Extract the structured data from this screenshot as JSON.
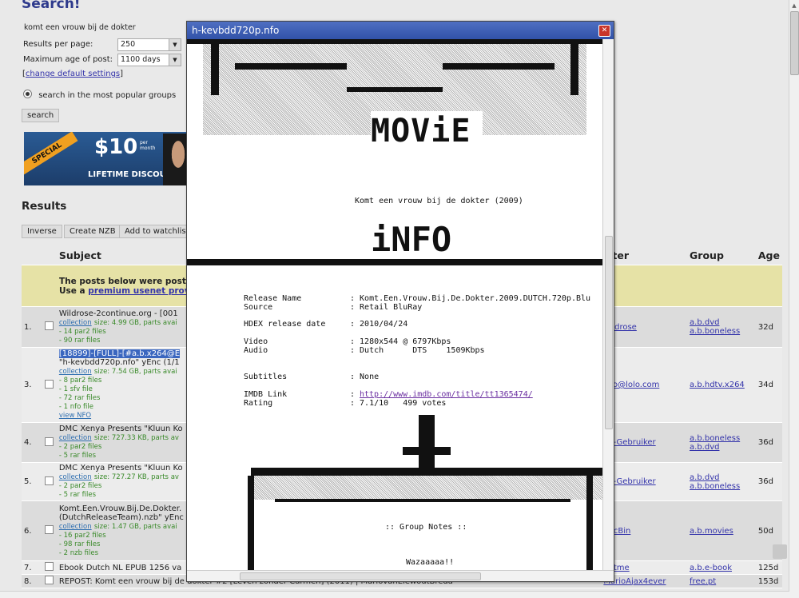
{
  "page": {
    "title": "Search!",
    "search_value": "komt een vrouw bij de dokter",
    "results_per_page_label": "Results per page:",
    "results_per_page_value": "250",
    "max_age_label": "Maximum age of post:",
    "max_age_value": "1100 days",
    "change_defaults_open": "[",
    "change_defaults_link": "change default settings",
    "change_defaults_close": "]",
    "popular_groups_label": "search in the most popular groups",
    "search_button": "search",
    "banner": {
      "special": "SPECIAL",
      "price": "$10",
      "per": "per month",
      "lifetime": "LIFETIME DISCOUNT"
    },
    "results_heading": "Results",
    "buttons": [
      "Inverse",
      "Create NZB",
      "Add to watchlist"
    ]
  },
  "table": {
    "headers": {
      "subject": "Subject",
      "poster": "Poster",
      "group": "Group",
      "age": "Age"
    },
    "notice_line1": "The posts below were poste",
    "notice_line2_prefix": "Use a ",
    "notice_link": "premium usenet prov",
    "rows": [
      {
        "num": "1.",
        "subject": "Wildrose-2continue.org - [001",
        "meta": "collection",
        "size": "size: 4.99 GB, parts avai",
        "extra": [
          "- 14 par2 files",
          "- 90 rar files"
        ],
        "poster": "wildrose",
        "groups": [
          "a.b.dvd",
          "a.b.boneless"
        ],
        "age": "32d"
      },
      {
        "num": "3.",
        "subject_sel": "[18899]-[FULL]-[#a.b.x264@E",
        "subject": "\"h-kevbdd720p.nfo\" yEnc (1/1",
        "meta": "collection",
        "size": "size: 7.54 GB, parts avai",
        "extra": [
          "- 8 par2 files",
          "- 1 sfv file",
          "- 72 rar files",
          "- 1 nfo file"
        ],
        "view_nfo": "view NFO",
        "poster": "lolo@lolo.com",
        "groups": [
          "a.b.hdtv.x264"
        ],
        "age": "34d"
      },
      {
        "num": "4.",
        "subject": "DMC Xenya Presents \"Kluun Ko",
        "meta": "collection",
        "size": "size: 727.33 KB, parts av",
        "extra": [
          "- 2 par2 files",
          "- 5 rar files"
        ],
        "poster": "SP-Gebruiker",
        "groups": [
          "a.b.boneless",
          "a.b.dvd"
        ],
        "age": "36d"
      },
      {
        "num": "5.",
        "subject": "DMC Xenya Presents \"Kluun Ko",
        "meta": "collection",
        "size": "size: 727.27 KB, parts av",
        "extra": [
          "- 2 par2 files",
          "- 5 rar files"
        ],
        "poster": "SP-Gebruiker",
        "groups": [
          "a.b.dvd",
          "a.b.boneless"
        ],
        "age": "36d"
      },
      {
        "num": "6.",
        "subject": "Komt.Een.Vrouw.Bij.De.Dokter.",
        "subject2": "(DutchReleaseTeam).nzb\" yEnc",
        "meta": "collection",
        "size": "size: 1.47 GB, parts avai",
        "extra": [
          "- 16 par2 files",
          "- 98 rar files",
          "- 2 nzb files"
        ],
        "poster": "encBin",
        "groups": [
          "a.b.movies"
        ],
        "age": "50d"
      },
      {
        "num": "7.",
        "subject": "Ebook Dutch NL EPUB 1256 va",
        "poster": "hetme",
        "groups": [
          "a.b.e-book"
        ],
        "age": "125d"
      },
      {
        "num": "8.",
        "subject": "REPOST: Komt een vrouw bij de dokter #2 [Leven zonder Carmen] (2011) | MariovanElewoutBreda",
        "poster": "MarioAjax4ever",
        "groups": [
          "free.pt"
        ],
        "age": "153d"
      }
    ]
  },
  "nfo_window": {
    "title": "h-kevbdd720p.nfo",
    "movie_word": "MOViE",
    "film_title": "Komt een vrouw bij de dokter (2009)",
    "info_word": "iNFO",
    "release_name_label": "Release Name",
    "release_name": ": Komt.Een.Vrouw.Bij.De.Dokter.2009.DUTCH.720p.Blu",
    "source_label": "Source",
    "source": ": Retail BluRay",
    "hdex_label": "HDEX release date",
    "hdex": ": 2010/04/24",
    "video_label": "Video",
    "video": ": 1280x544 @ 6797Kbps",
    "audio_label": "Audio",
    "audio": ": Dutch      DTS    1509Kbps",
    "subtitles_label": "Subtitles",
    "subtitles": ": None",
    "imdb_label": "IMDB Link",
    "imdb_colon": ":",
    "imdb_link": "http://www.imdb.com/title/tt1365474/",
    "rating_label": "Rating",
    "rating": ": 7.1/10   499 votes",
    "group_notes": ":: Group Notes ::",
    "notes_text": "Wazaaaaa!!"
  }
}
